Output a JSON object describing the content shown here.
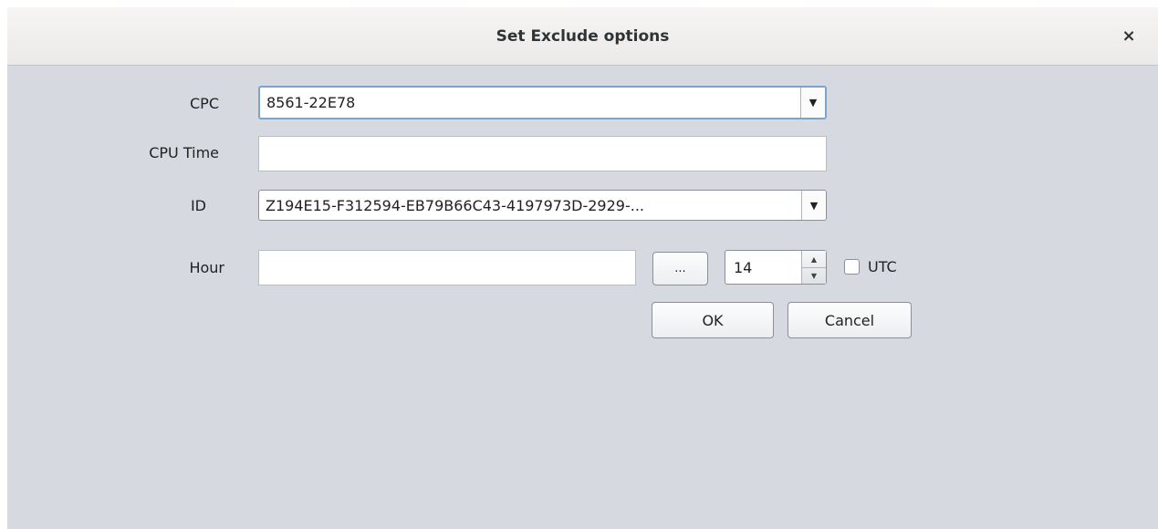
{
  "dialog": {
    "title": "Set Exclude options",
    "close_glyph": "×"
  },
  "form": {
    "cpc": {
      "label": "CPC",
      "value": "8561-22E78",
      "arrow": "▼"
    },
    "cpu_time": {
      "label": "CPU Time",
      "value": ""
    },
    "id": {
      "label": "ID",
      "value": "Z194E15-F312594-EB79B66C43-4197973D-2929-...",
      "arrow": "▼"
    },
    "hour": {
      "label": "Hour",
      "value": "",
      "browse_label": "...",
      "spinner_value": "14",
      "spinner_up": "▲",
      "spinner_down": "▼",
      "utc_label": "UTC",
      "utc_checked": false
    }
  },
  "buttons": {
    "ok": "OK",
    "cancel": "Cancel"
  }
}
